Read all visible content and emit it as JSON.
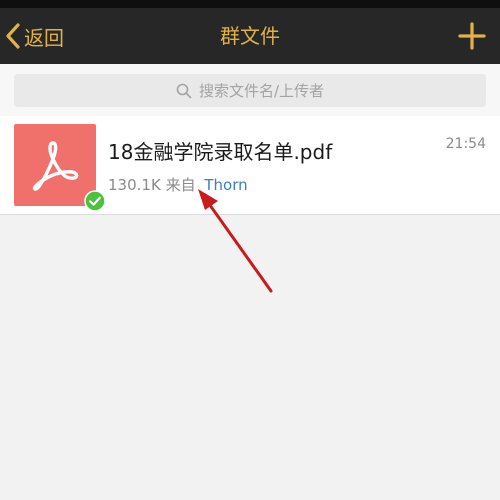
{
  "navbar": {
    "back_label": "返回",
    "title": "群文件",
    "back_icon": "chevron-left-icon",
    "add_icon": "plus-icon"
  },
  "search": {
    "placeholder": "搜索文件名/上传者",
    "icon": "search-icon"
  },
  "files": [
    {
      "name": "18金融学院录取名单.pdf",
      "time": "21:54",
      "size": "130.1K",
      "from_label": "来自",
      "uploader": "Thorn",
      "type_icon": "pdf-icon",
      "status_icon": "check-circle-icon"
    }
  ],
  "colors": {
    "nav_bg": "#272727",
    "accent": "#e2b24a",
    "pdf_thumb": "#f0706c",
    "link": "#3b7fc4",
    "check": "#4cc13b",
    "annotation_arrow": "#c91b1b"
  }
}
